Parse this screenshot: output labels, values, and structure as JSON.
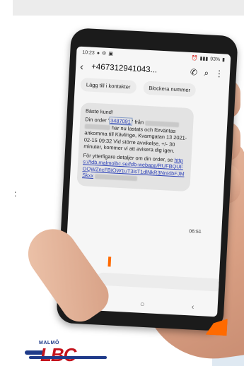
{
  "status_bar": {
    "time": "10:23",
    "battery": "93%"
  },
  "chat": {
    "contact_number": "+467312941043...",
    "add_contact": "Lägg till i kontakter",
    "block_number": "Blockera nummer"
  },
  "message": {
    "greeting": "Bäste kund!",
    "order_prefix": "Din order '",
    "order_number": "3487091",
    "order_suffix": "' från",
    "line2": "har nu lastats och förväntas",
    "line3": "ankomma till Kävlinge, Kvarngatan 13",
    "line4": "2021-02-15 09:32",
    "line5": "Vid större avvikelse, +/- 30 minuter,",
    "line6": "kommer vi att avisera dig igen.",
    "line7": "För ytterligare detaljer om din order, se",
    "link": "https://fdb.malmolbc.se/fdb-webapp/RUFBQUFOQWZncFBIOW1uT3lsT1dlNkR3NnI4bFJMSkxx",
    "time": "06:51"
  },
  "logo": {
    "top": "MALMÖ",
    "main": "LBC"
  },
  "colors": {
    "accent": "#ff6a00",
    "link": "#2a3fb8",
    "brand_red": "#c4141e",
    "brand_blue": "#1f3b8a"
  }
}
